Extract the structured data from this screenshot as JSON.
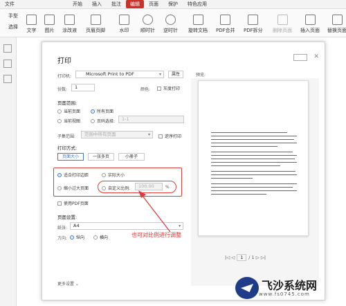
{
  "menubar": {
    "file": "文件",
    "tabs": [
      "开始",
      "插入",
      "批注",
      "编辑",
      "页面",
      "保护",
      "特色应用"
    ]
  },
  "toolbar": {
    "hand": "手型",
    "select": "选择",
    "items": [
      "文字",
      "图片",
      "涂改液",
      "页眉页脚",
      "水印",
      "顺时针",
      "逆时针",
      "旋转文档",
      "PDF合并",
      "PDF拆分",
      "删除页面",
      "插入页面",
      "替换页面"
    ]
  },
  "dialog": {
    "title": "打印",
    "printer_label": "打印机:",
    "printer_value": "Microsoft Print to PDF",
    "properties": "属性",
    "copies_label": "份数:",
    "copies_value": "1",
    "color_label": "颜色:",
    "grayscale": "灰度打印",
    "page_range_title": "页面范围:",
    "range_current": "当前页面",
    "range_all": "所有页面",
    "range_view": "当前视图",
    "range_select": "页码选择:",
    "range_select_placeholder": "1-1",
    "subset_label": "子集范围:",
    "subset_value": "范围中所有页面",
    "reverse": "逆序打印",
    "print_mode_title": "打印方式:",
    "mode_buttons": [
      "页面大小",
      "一张多页",
      "小册子"
    ],
    "fit_print_area": "适合打印边距",
    "actual_size": "实际大小",
    "shrink_large": "缩小过大页面",
    "custom_scale": "自定义比例:",
    "scale_value": "100.00",
    "percent": "%",
    "use_pdf_size": "使用PDF页面",
    "page_setup_title": "页面设置:",
    "paper_label": "纸张:",
    "paper_value": "A4",
    "direction_label": "方向:",
    "portrait": "纵向",
    "landscape": "横向",
    "more_settings": "更多设置",
    "preview_label": "预览:",
    "page_current": "1",
    "page_total": "/ 1"
  },
  "annotation": "也可对比例进行调整",
  "watermark": {
    "name": "飞沙系统网",
    "url": "www.fs0745.com"
  }
}
